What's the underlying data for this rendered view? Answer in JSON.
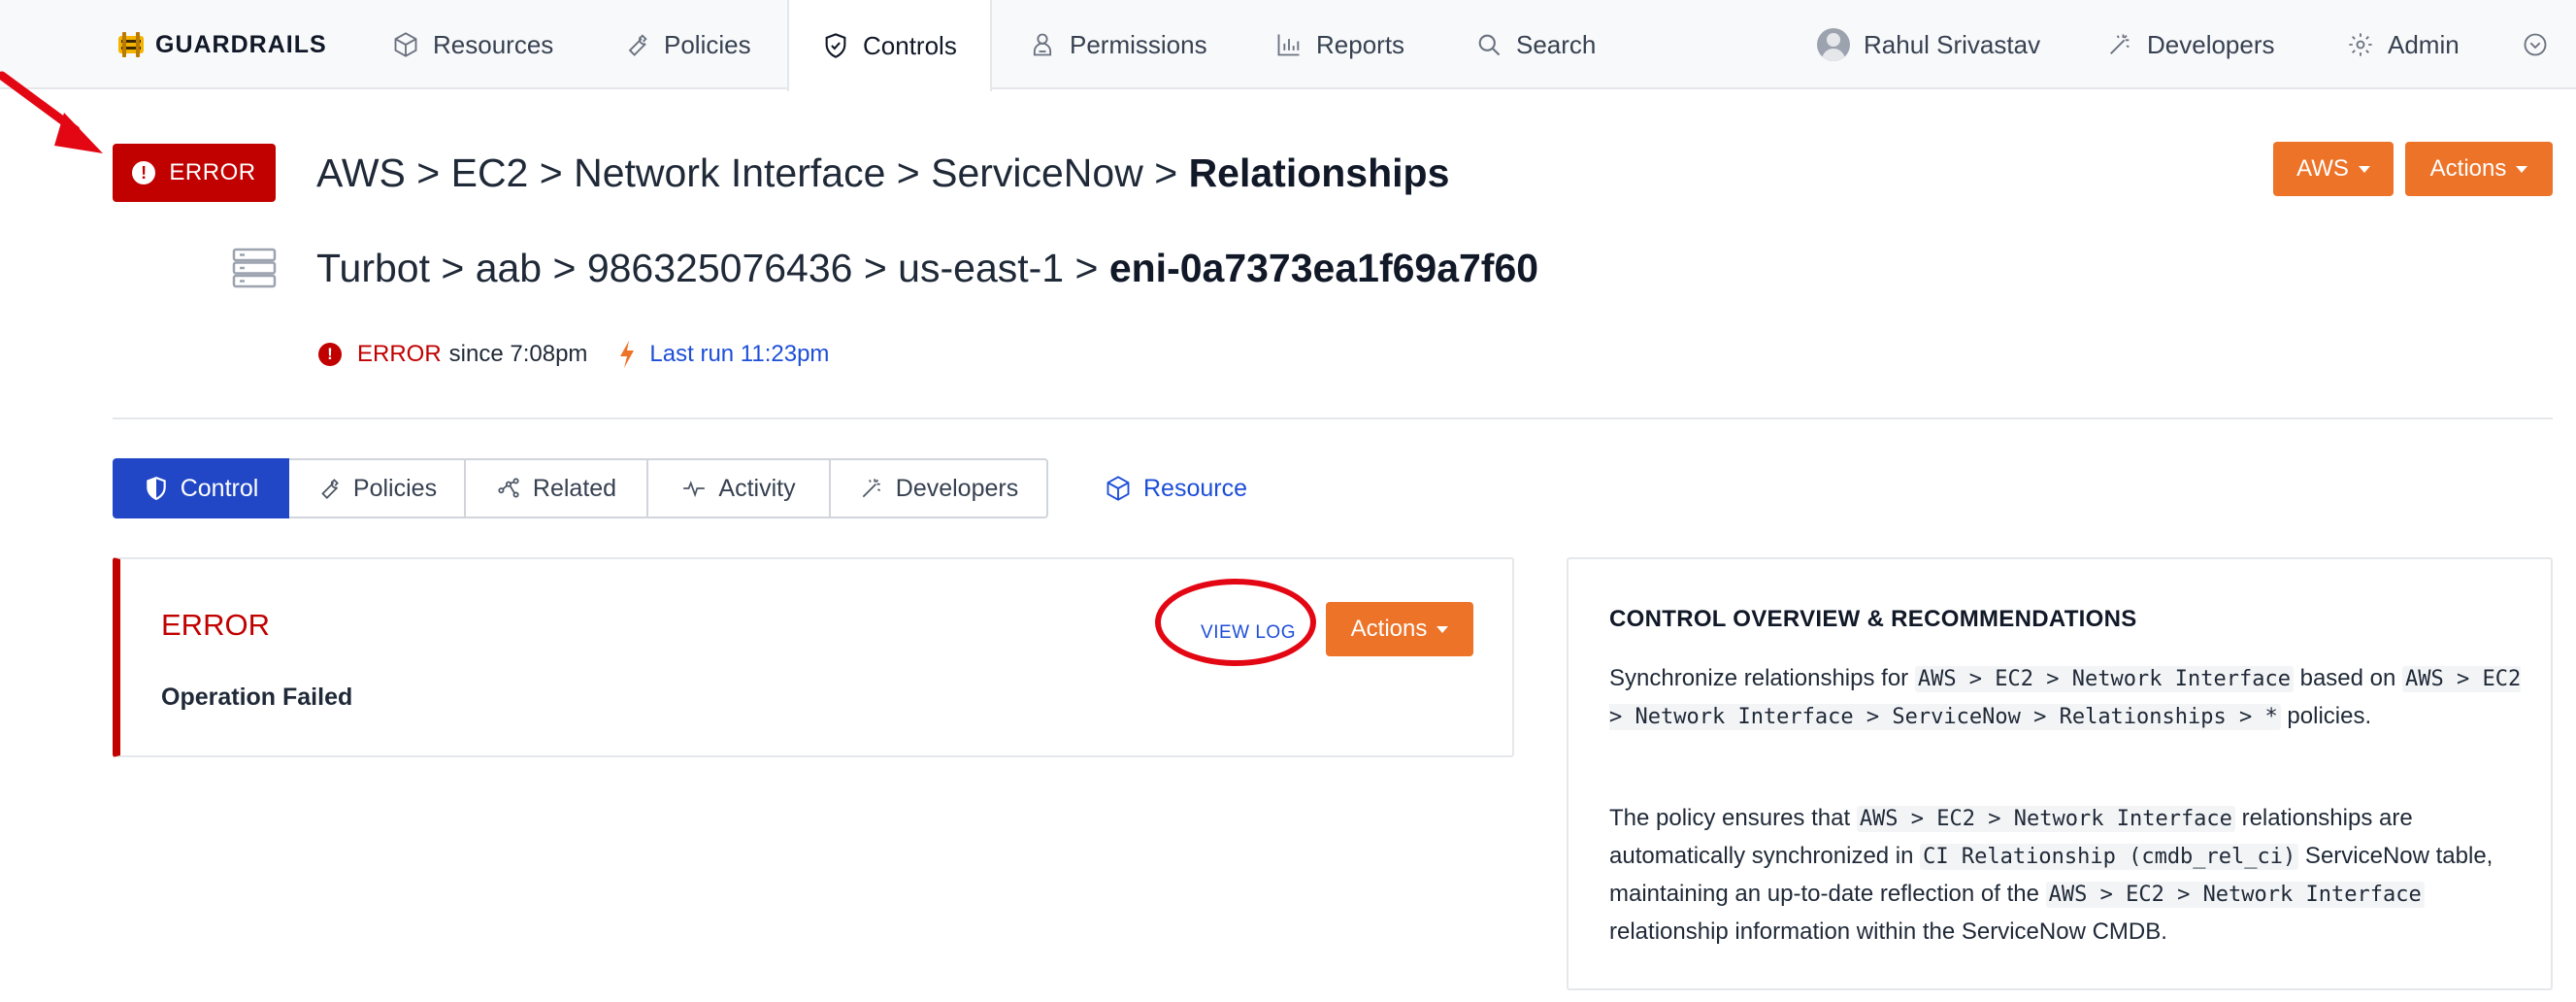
{
  "nav": {
    "brand": "GUARDRAILS",
    "items": [
      {
        "label": "Resources",
        "icon": "cube-icon"
      },
      {
        "label": "Policies",
        "icon": "wrench-icon"
      },
      {
        "label": "Controls",
        "icon": "shield-check-icon"
      },
      {
        "label": "Permissions",
        "icon": "user-badge-icon"
      },
      {
        "label": "Reports",
        "icon": "bar-chart-icon"
      },
      {
        "label": "Search",
        "icon": "search-icon"
      }
    ],
    "user": "Rahul Srivastav",
    "developers": "Developers",
    "admin": "Admin"
  },
  "header": {
    "status_badge": "ERROR",
    "policy_path": "AWS > EC2 > Network Interface > ServiceNow > ",
    "policy_path_bold": "Relationships",
    "resource_path": "Turbot > aab > 986325076436 > us-east-1 > ",
    "resource_path_bold": "eni-0a7373ea1f69a7f60",
    "status_text": "ERROR",
    "since_text": "since 7:08pm",
    "last_run": "Last run 11:23pm",
    "aws_button": "AWS",
    "actions_button": "Actions"
  },
  "tabs": [
    {
      "label": "Control",
      "icon": "shield-half-icon",
      "active": true
    },
    {
      "label": "Policies",
      "icon": "wrench-icon",
      "active": false
    },
    {
      "label": "Related",
      "icon": "graph-nodes-icon",
      "active": false
    },
    {
      "label": "Activity",
      "icon": "pulse-icon",
      "active": false
    },
    {
      "label": "Developers",
      "icon": "magic-wand-icon",
      "active": false
    }
  ],
  "resource_link": "Resource",
  "error_card": {
    "title": "ERROR",
    "subtitle": "Operation Failed",
    "view_log": "VIEW LOG",
    "actions": "Actions"
  },
  "overview": {
    "title": "CONTROL OVERVIEW & RECOMMENDATIONS",
    "p1_a": "Synchronize relationships for ",
    "p1_code1": "AWS > EC2 > Network Interface",
    "p1_b": " based on ",
    "p1_code2": "AWS > EC2 > Network Interface > ServiceNow > Relationships > *",
    "p1_c": " policies.",
    "p2_a": "The policy ensures that ",
    "p2_code1": "AWS > EC2 > Network Interface",
    "p2_b": " relationships are automatically synchronized in ",
    "p2_code2": "CI Relationship (cmdb_rel_ci)",
    "p2_c": " ServiceNow table, maintaining an up-to-date reflection of the ",
    "p2_code3": "AWS > EC2 > Network Interface",
    "p2_d": " relationship information within the ServiceNow CMDB."
  },
  "colors": {
    "error_red": "#c10000",
    "accent_orange": "#ed7328",
    "primary_blue": "#2147c6",
    "link_blue": "#1d4ed8",
    "annotation_red": "#e30613"
  }
}
